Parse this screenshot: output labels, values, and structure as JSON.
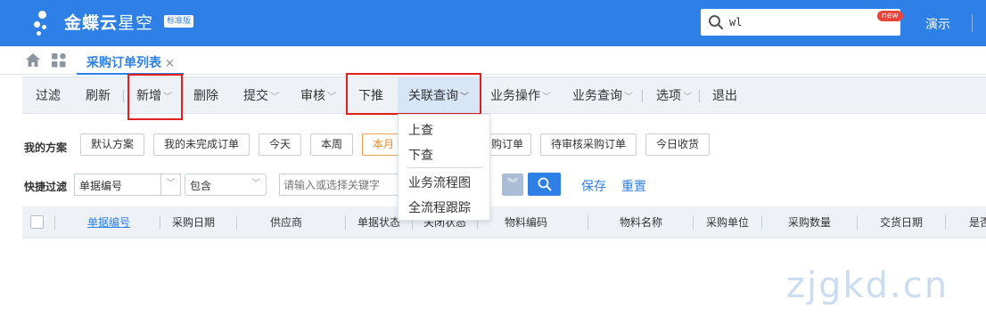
{
  "header": {
    "brand_main": "金蝶云",
    "brand_sub": "星空",
    "edition": "标准版",
    "search_value": "wl",
    "new_badge": "new",
    "user": "演示"
  },
  "tabs": {
    "active_label": "采购订单列表",
    "close_glyph": "×"
  },
  "toolbar": {
    "items": [
      "过滤",
      "刷新",
      "新增",
      "删除",
      "提交",
      "审核",
      "下推",
      "关联查询",
      "业务操作",
      "业务查询",
      "选项",
      "退出"
    ],
    "caret": "﹀"
  },
  "dropdown": {
    "items": [
      "上查",
      "下查",
      "业务流程图",
      "全流程跟踪"
    ]
  },
  "scheme": {
    "label": "我的方案",
    "buttons": [
      "默认方案",
      "我的未完成订单",
      "今天",
      "本周",
      "本月",
      "购订单",
      "待审核采购订单",
      "今日收货"
    ]
  },
  "quick_filter": {
    "label": "快捷过滤",
    "field": "单据编号",
    "operator": "包含",
    "keyword_placeholder": "请输入或选择关键字",
    "save": "保存",
    "reset": "重置"
  },
  "grid": {
    "columns": [
      "单据编号",
      "采购日期",
      "供应商",
      "单据状态",
      "关闭状态",
      "物料编码",
      "物料名称",
      "采购单位",
      "采购数量",
      "交货日期",
      "是否"
    ]
  },
  "watermark": "zjgkd.cn",
  "colors": {
    "brand_blue": "#2e7fe6",
    "highlight_red": "#e0201d",
    "toolbar_bg": "#eef2f7"
  }
}
